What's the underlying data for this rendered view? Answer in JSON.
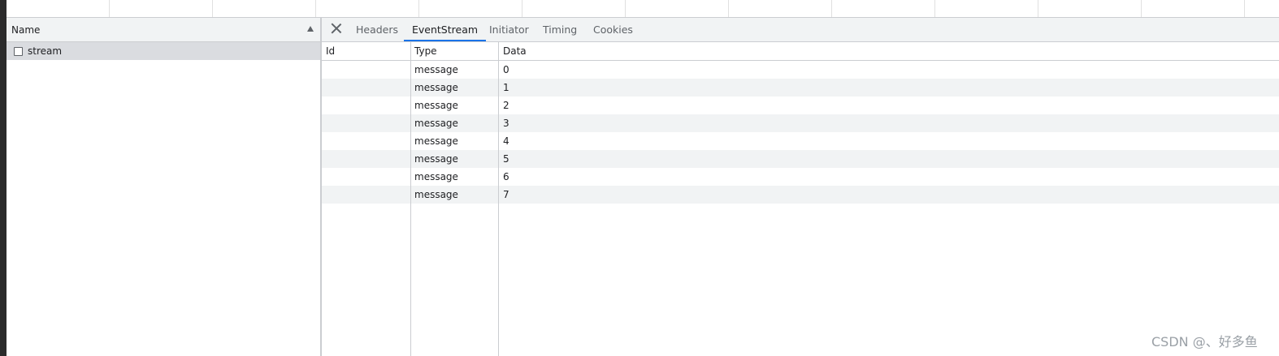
{
  "name_panel": {
    "header": "Name",
    "requests": [
      {
        "label": "stream"
      }
    ]
  },
  "details": {
    "tabs": [
      "Headers",
      "EventStream",
      "Initiator",
      "Timing",
      "Cookies"
    ],
    "active_tab": "EventStream",
    "columns": [
      "Id",
      "Type",
      "Data"
    ],
    "rows": [
      {
        "id": "",
        "type": "message",
        "data": "0"
      },
      {
        "id": "",
        "type": "message",
        "data": "1"
      },
      {
        "id": "",
        "type": "message",
        "data": "2"
      },
      {
        "id": "",
        "type": "message",
        "data": "3"
      },
      {
        "id": "",
        "type": "message",
        "data": "4"
      },
      {
        "id": "",
        "type": "message",
        "data": "5"
      },
      {
        "id": "",
        "type": "message",
        "data": "6"
      },
      {
        "id": "",
        "type": "message",
        "data": "7"
      }
    ]
  },
  "watermark": "CSDN @、好多鱼",
  "colors": {
    "accent": "#1a73e8",
    "selected_row": "#dadce0",
    "stripe": "#f1f3f4"
  },
  "icons": [
    "close-icon",
    "sort-ascending-icon",
    "document-icon"
  ]
}
